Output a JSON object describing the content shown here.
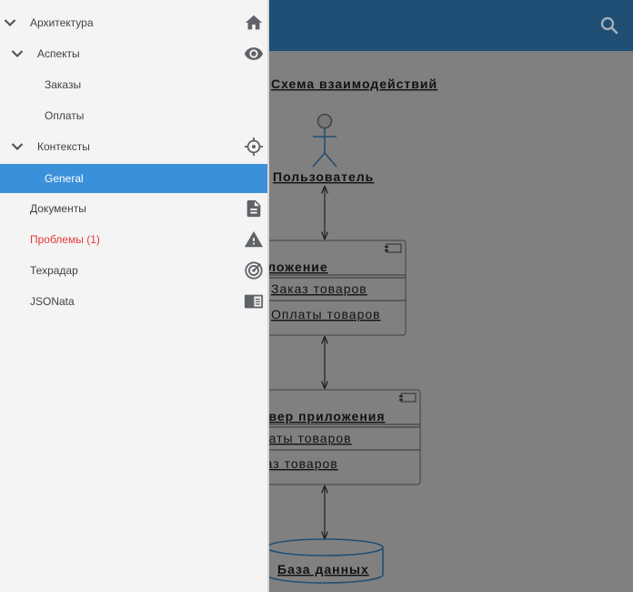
{
  "diagram": {
    "title": "Схема взаимодействий",
    "actor": "Пользователь",
    "components": [
      {
        "name": "Приложение",
        "items": [
          "Заказ товаров",
          "Оплаты товаров"
        ]
      },
      {
        "name": "Сервер приложения",
        "items": [
          "Оплаты товаров",
          "Заказ товаров"
        ]
      }
    ],
    "database": "База данных"
  },
  "sidebar": {
    "items": [
      {
        "label": "Архитектура",
        "icon": "home-icon"
      },
      {
        "label": "Аспекты",
        "icon": "eye-icon"
      },
      {
        "label": "Заказы"
      },
      {
        "label": "Оплаты"
      },
      {
        "label": "Контексты",
        "icon": "crosshair-icon"
      },
      {
        "label": "General"
      },
      {
        "label": "Документы",
        "icon": "document-icon"
      },
      {
        "label": "Проблемы (1)",
        "icon": "warning-icon"
      },
      {
        "label": "Техрадар",
        "icon": "radar-icon"
      },
      {
        "label": "JSONata",
        "icon": "json-reader-icon"
      }
    ]
  },
  "colors": {
    "appbar": "#1f4f74",
    "drawer_background": "#f4f4f4",
    "active_item": "#3a91da",
    "error_text": "#e53935",
    "icon": "#5f6368",
    "diagram_line": "#1f4f74"
  }
}
